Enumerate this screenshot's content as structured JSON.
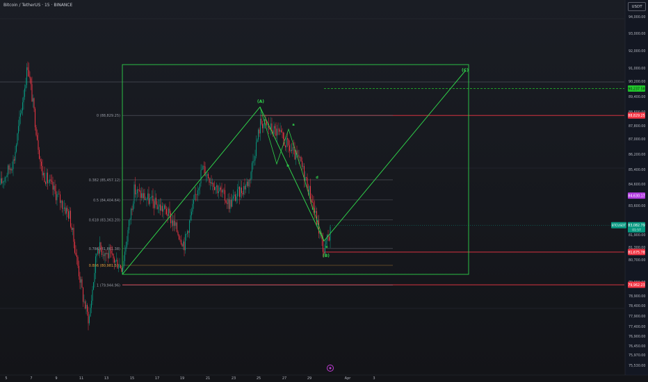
{
  "header": {
    "symbol_title": "Bitcoin / TetherUS · 15 · BINANCE",
    "currency_label": "USDT"
  },
  "colors": {
    "up": "#089981",
    "down": "#f23645",
    "wave": "#2fd14a",
    "fib": "#787b86",
    "axis_text": "#b2b5be"
  },
  "price_axis": {
    "ticks": [
      "94,000.00",
      "93,000.00",
      "92,000.00",
      "91,000.00",
      "90,200.00",
      "89,400.00",
      "88,600.00",
      "87,800.00",
      "87,000.00",
      "86,200.00",
      "85,400.00",
      "84,600.00",
      "83,600.00",
      "82,500.00",
      "81,900.00",
      "81,300.00",
      "80,700.00",
      "79,900.00",
      "78,900.00",
      "78,400.00",
      "77,900.00",
      "77,400.00",
      "76,900.00",
      "76,450.00",
      "75,970.00",
      "75,530.00"
    ]
  },
  "price_labels": [
    {
      "id": "green",
      "text": "90,237.58",
      "price": 90237.58,
      "bg": "#22c92d",
      "fg": "#0b1a0b"
    },
    {
      "id": "red-top",
      "text": "88,829.25",
      "price": 88829.25,
      "bg": "#f23645",
      "fg": "#ffffff"
    },
    {
      "id": "purple",
      "text": "84,630.17",
      "price": 84630.17,
      "bg": "#b23ce0",
      "fg": "#ffffff"
    },
    {
      "id": "red-low",
      "text": "81,675.78",
      "price": 81675.78,
      "bg": "#f23645",
      "fg": "#ffffff"
    },
    {
      "id": "red-bottom",
      "text": "79,962.23",
      "price": 79962.23,
      "bg": "#f23645",
      "fg": "#ffffff"
    }
  ],
  "current_price": {
    "symbol": "BTCUSDT",
    "price": "83,082.79",
    "countdown": "01:57",
    "value": 83082.79
  },
  "time_axis": {
    "ticks": [
      "5",
      "7",
      "9",
      "11",
      "13",
      "15",
      "17",
      "19",
      "21",
      "23",
      "25",
      "27",
      "29",
      "Apr",
      "3"
    ]
  },
  "fib_levels": [
    {
      "label": "0 (88,829.25)",
      "price": 88829.25
    },
    {
      "label": "0.382 (85,457.12)",
      "price": 85457.12
    },
    {
      "label": "0.5 (84,404.64)",
      "price": 84404.64
    },
    {
      "label": "0.618 (83,363.20)",
      "price": 83363.2
    },
    {
      "label": "0.786 (81,861.38)",
      "price": 81861.38
    },
    {
      "label": "0.886 (80,981.55)",
      "price": 80981.55
    },
    {
      "label": "1 (79,944.96)",
      "price": 79944.96
    }
  ],
  "wave_labels": {
    "A": "(A)",
    "B": "(B)",
    "C": "(C)",
    "sub_a": "a",
    "sub_b": "b",
    "sub_c": "c",
    "sub_d": "d",
    "sub_e": "e"
  },
  "watermark": "TradingView"
}
